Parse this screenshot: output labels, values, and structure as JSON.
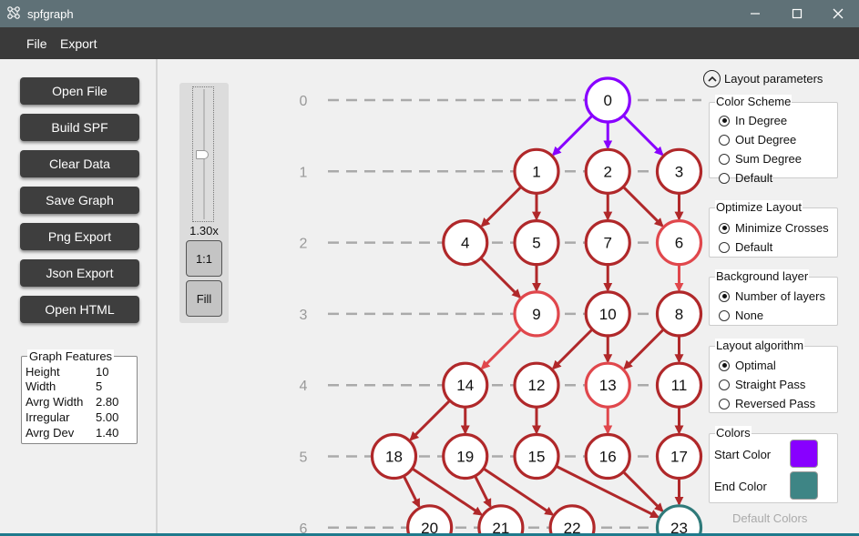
{
  "window": {
    "title": "spfgraph",
    "controls": [
      "minimize-icon",
      "maximize-icon",
      "close-icon"
    ]
  },
  "menu": [
    "File",
    "Export"
  ],
  "sidebar": {
    "buttons": [
      "Open File",
      "Build SPF",
      "Clear Data",
      "Save Graph",
      "Png Export",
      "Json Export",
      "Open HTML"
    ],
    "features": {
      "title": "Graph Features",
      "rows": [
        {
          "key": "Height",
          "value": "10"
        },
        {
          "key": "Width",
          "value": "5"
        },
        {
          "key": "Avrg Width",
          "value": "2.80"
        },
        {
          "key": "Irregular",
          "value": "5.00"
        },
        {
          "key": "Avrg Dev",
          "value": "1.40"
        }
      ]
    }
  },
  "zoom": {
    "level_label": "1.30x",
    "slider_fraction": 0.48,
    "buttons": [
      "1:1",
      "Fill"
    ]
  },
  "graph": {
    "layers": [
      "0",
      "1",
      "2",
      "3",
      "4",
      "5",
      "6"
    ],
    "colors": {
      "start": "#8800ff",
      "end": "#2f7a7a",
      "dark": "#b0282a",
      "light": "#e0474c",
      "layer_line": "#aaaaaa"
    },
    "nodes": [
      {
        "id": "0",
        "layer": 0,
        "slot": 4,
        "style": "start"
      },
      {
        "id": "1",
        "layer": 1,
        "slot": 3,
        "style": "dark"
      },
      {
        "id": "2",
        "layer": 1,
        "slot": 4,
        "style": "dark"
      },
      {
        "id": "3",
        "layer": 1,
        "slot": 5,
        "style": "dark"
      },
      {
        "id": "4",
        "layer": 2,
        "slot": 2,
        "style": "dark"
      },
      {
        "id": "5",
        "layer": 2,
        "slot": 3,
        "style": "dark"
      },
      {
        "id": "7",
        "layer": 2,
        "slot": 4,
        "style": "dark"
      },
      {
        "id": "6",
        "layer": 2,
        "slot": 5,
        "style": "light"
      },
      {
        "id": "9",
        "layer": 3,
        "slot": 3,
        "style": "light"
      },
      {
        "id": "10",
        "layer": 3,
        "slot": 4,
        "style": "dark"
      },
      {
        "id": "8",
        "layer": 3,
        "slot": 5,
        "style": "dark"
      },
      {
        "id": "14",
        "layer": 4,
        "slot": 2,
        "style": "dark"
      },
      {
        "id": "12",
        "layer": 4,
        "slot": 3,
        "style": "dark"
      },
      {
        "id": "13",
        "layer": 4,
        "slot": 4,
        "style": "light"
      },
      {
        "id": "11",
        "layer": 4,
        "slot": 5,
        "style": "dark"
      },
      {
        "id": "18",
        "layer": 5,
        "slot": 1,
        "style": "dark"
      },
      {
        "id": "19",
        "layer": 5,
        "slot": 2,
        "style": "dark"
      },
      {
        "id": "15",
        "layer": 5,
        "slot": 3,
        "style": "dark"
      },
      {
        "id": "16",
        "layer": 5,
        "slot": 4,
        "style": "dark"
      },
      {
        "id": "17",
        "layer": 5,
        "slot": 5,
        "style": "dark"
      },
      {
        "id": "20",
        "layer": 6,
        "slot": 1.5,
        "style": "dark"
      },
      {
        "id": "21",
        "layer": 6,
        "slot": 2.5,
        "style": "dark"
      },
      {
        "id": "22",
        "layer": 6,
        "slot": 3.5,
        "style": "dark"
      },
      {
        "id": "23",
        "layer": 6,
        "slot": 5,
        "style": "end"
      }
    ],
    "edges": [
      [
        "0",
        "1",
        "start"
      ],
      [
        "0",
        "2",
        "start"
      ],
      [
        "0",
        "3",
        "start"
      ],
      [
        "1",
        "4",
        "dark"
      ],
      [
        "1",
        "5",
        "dark"
      ],
      [
        "2",
        "7",
        "dark"
      ],
      [
        "2",
        "6",
        "dark"
      ],
      [
        "3",
        "6",
        "dark"
      ],
      [
        "4",
        "9",
        "dark"
      ],
      [
        "5",
        "9",
        "dark"
      ],
      [
        "7",
        "10",
        "dark"
      ],
      [
        "6",
        "8",
        "light"
      ],
      [
        "9",
        "14",
        "light"
      ],
      [
        "10",
        "12",
        "dark"
      ],
      [
        "10",
        "13",
        "dark"
      ],
      [
        "8",
        "13",
        "dark"
      ],
      [
        "8",
        "11",
        "dark"
      ],
      [
        "14",
        "18",
        "dark"
      ],
      [
        "14",
        "19",
        "dark"
      ],
      [
        "12",
        "15",
        "dark"
      ],
      [
        "13",
        "16",
        "light"
      ],
      [
        "11",
        "17",
        "dark"
      ],
      [
        "18",
        "20",
        "dark"
      ],
      [
        "18",
        "21",
        "dark"
      ],
      [
        "19",
        "21",
        "dark"
      ],
      [
        "19",
        "22",
        "dark"
      ],
      [
        "15",
        "23",
        "dark"
      ],
      [
        "16",
        "23",
        "dark"
      ],
      [
        "17",
        "23",
        "dark"
      ]
    ]
  },
  "settings": {
    "toggle_label": "Layout parameters",
    "groups": [
      {
        "title": "Color Scheme",
        "options": [
          "In Degree",
          "Out Degree",
          "Sum Degree",
          "Default"
        ],
        "selected": 0
      },
      {
        "title": "Optimize Layout",
        "options": [
          "Minimize Crosses",
          "Default"
        ],
        "selected": 0
      },
      {
        "title": "Background layer",
        "options": [
          "Number of layers",
          "None"
        ],
        "selected": 0
      },
      {
        "title": "Layout algorithm",
        "options": [
          "Optimal",
          "Straight Pass",
          "Reversed Pass"
        ],
        "selected": 0
      }
    ],
    "colors": {
      "title": "Colors",
      "start_label": "Start Color",
      "end_label": "End Color",
      "start_value": "#8800ff",
      "end_value": "#3e8585"
    },
    "default_colors_label": "Default Colors"
  }
}
